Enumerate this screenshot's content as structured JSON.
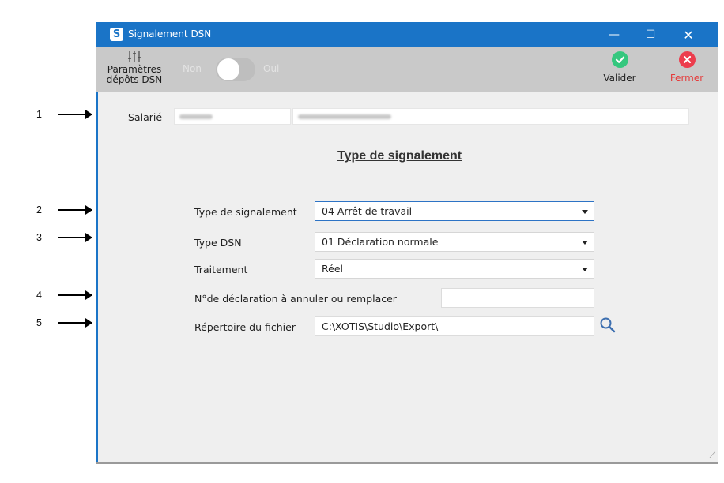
{
  "callouts": [
    "1",
    "2",
    "3",
    "4",
    "5"
  ],
  "window": {
    "app_logo": "S",
    "title": "Signalement DSN",
    "controls": {
      "minimize": "—",
      "maximize": "☐",
      "close": "✕"
    }
  },
  "toolbar": {
    "params_icon": "sliders-icon",
    "params_label_line1": "Paramètres",
    "params_label_line2": "dépôts DSN",
    "toggle_off_label": "Non",
    "toggle_on_label": "Oui",
    "toggle_state": "Non",
    "validate_label": "Valider",
    "close_label": "Fermer",
    "validate_color": "#35c77e",
    "close_color": "#ec3d4d"
  },
  "employee": {
    "label": "Salarié"
  },
  "section_title": "Type de signalement",
  "form": {
    "signal_type_label": "Type de signalement",
    "signal_type_value": "04 Arrêt de travail",
    "dsn_type_label": "Type DSN",
    "dsn_type_value": "01 Déclaration normale",
    "processing_label": "Traitement",
    "processing_value": "Réel",
    "cancel_number_label": "N°de déclaration à annuler ou remplacer",
    "cancel_number_value": "",
    "directory_label": "Répertoire du fichier",
    "directory_value": "C:\\XOTIS\\Studio\\Export\\",
    "search_icon": "magnifier-icon"
  },
  "colors": {
    "titlebar": "#1a74c7",
    "toolbar": "#c9c9c9",
    "body": "#efefef",
    "focus_border": "#2d73c5"
  }
}
